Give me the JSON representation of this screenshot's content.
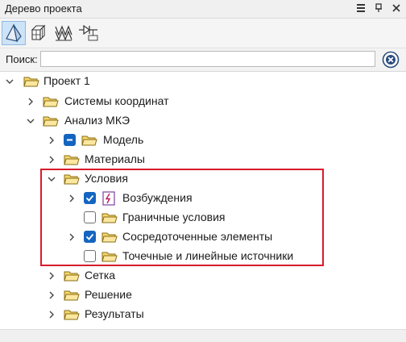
{
  "panel": {
    "title": "Дерево проекта"
  },
  "search": {
    "label": "Поиск:",
    "value": "",
    "placeholder": ""
  },
  "tree": {
    "root": "Проект 1",
    "coord_systems": "Системы координат",
    "fea": "Анализ МКЭ",
    "model": "Модель",
    "materials": "Материалы",
    "conditions": "Условия",
    "excitations": "Возбуждения",
    "boundary": "Граничные условия",
    "lumped": "Сосредоточенные элементы",
    "sources": "Точечные и линейные источники",
    "mesh": "Сетка",
    "solution": "Решение",
    "results": "Результаты"
  },
  "colors": {
    "accent": "#1565c0",
    "highlight": "#d81b2a",
    "folder": "#f5d76e"
  }
}
